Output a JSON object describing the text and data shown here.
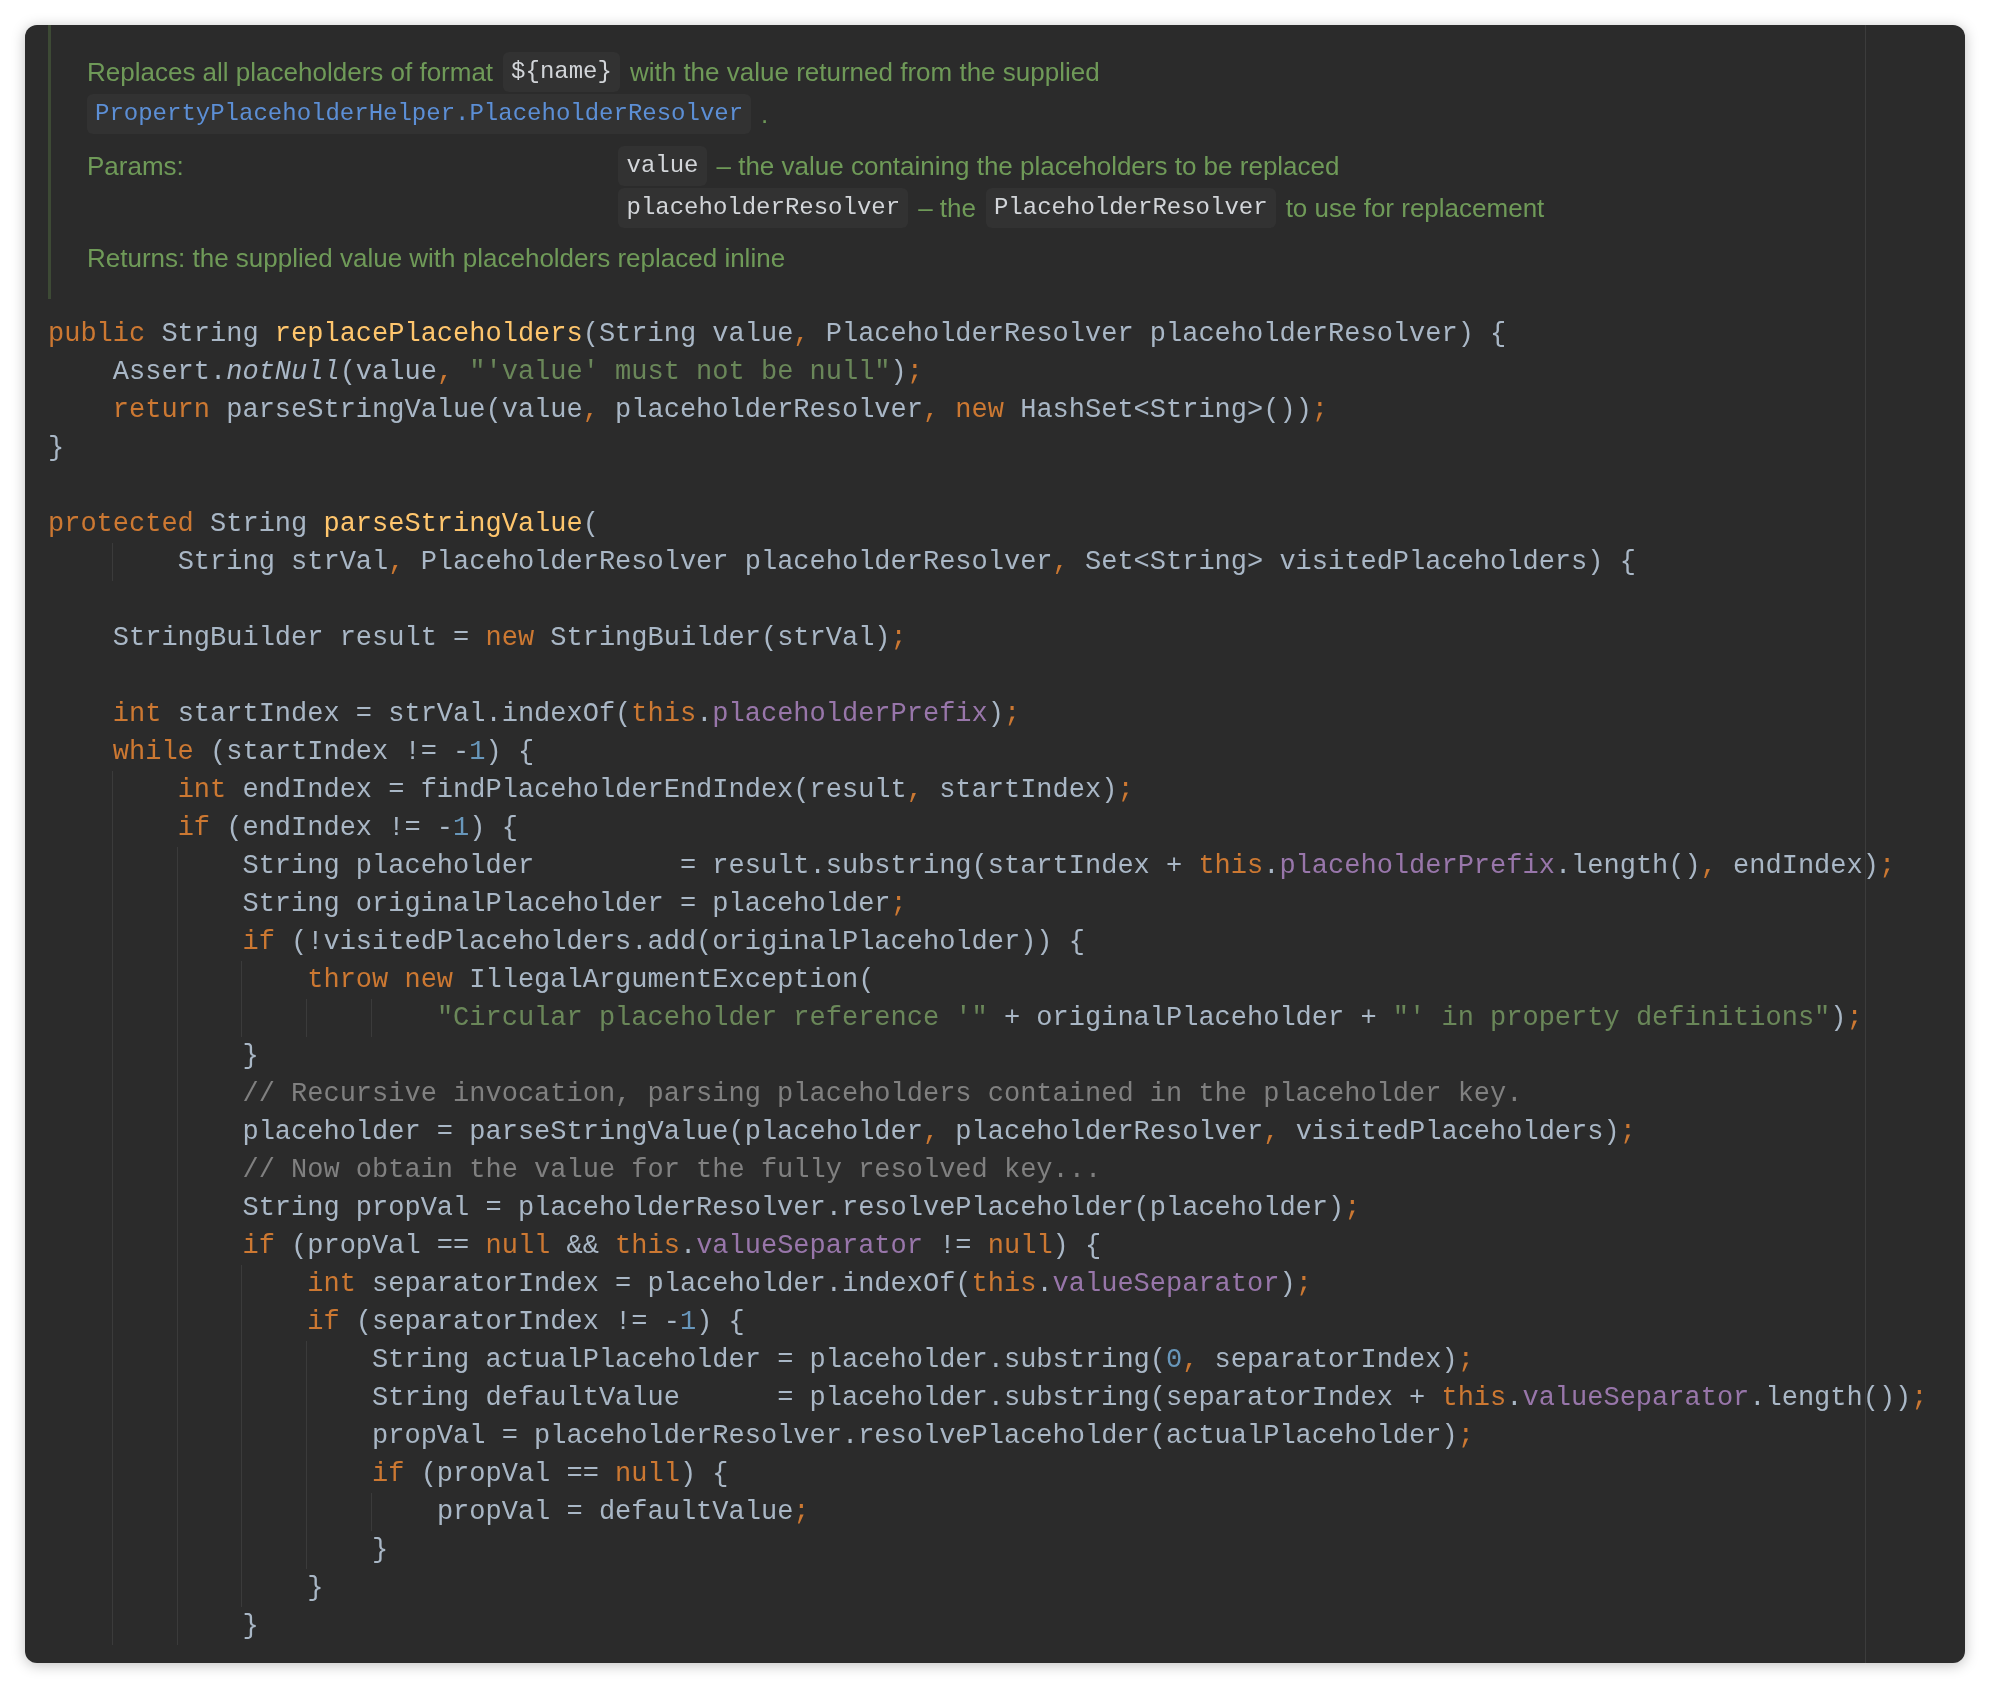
{
  "doc": {
    "summary": [
      [
        {
          "kind": "text",
          "text": "Replaces all placeholders of format"
        },
        {
          "kind": "code",
          "text": "${name}"
        },
        {
          "kind": "text",
          "text": "with the value returned from the supplied"
        }
      ],
      [
        {
          "kind": "link",
          "text": "PropertyPlaceholderHelper.PlaceholderResolver"
        },
        {
          "kind": "text",
          "text": "."
        }
      ]
    ],
    "params_label": "Params:",
    "params": [
      {
        "name": "value",
        "description": [
          {
            "kind": "text",
            "text": "– the value containing the placeholders to be replaced"
          }
        ]
      },
      {
        "name": "placeholderResolver",
        "description": [
          {
            "kind": "text",
            "text": "– the"
          },
          {
            "kind": "code",
            "text": "PlaceholderResolver"
          },
          {
            "kind": "text",
            "text": "to use for replacement"
          }
        ]
      }
    ],
    "returns": "Returns: the supplied value with placeholders replaced inline"
  },
  "code": [
    {
      "kind": "code",
      "tokens": [
        {
          "kind": "keyword",
          "text": "public "
        },
        {
          "kind": "plain",
          "text": "String "
        },
        {
          "kind": "method",
          "text": "replacePlaceholders"
        },
        {
          "kind": "plain",
          "text": "(String value"
        },
        {
          "kind": "keyword",
          "text": ", "
        },
        {
          "kind": "plain",
          "text": "PlaceholderResolver placeholderResolver) {"
        }
      ]
    },
    {
      "kind": "code",
      "tokens": [
        {
          "kind": "plain",
          "text": "    Assert."
        },
        {
          "kind": "italic",
          "text": "notNull"
        },
        {
          "kind": "plain",
          "text": "(value"
        },
        {
          "kind": "keyword",
          "text": ", "
        },
        {
          "kind": "string",
          "text": "\"'value' must not be null\""
        },
        {
          "kind": "plain",
          "text": ")"
        },
        {
          "kind": "keyword",
          "text": ";"
        }
      ]
    },
    {
      "kind": "code",
      "tokens": [
        {
          "kind": "keyword",
          "text": "    return "
        },
        {
          "kind": "plain",
          "text": "parseStringValue(value"
        },
        {
          "kind": "keyword",
          "text": ", "
        },
        {
          "kind": "plain",
          "text": "placeholderResolver"
        },
        {
          "kind": "keyword",
          "text": ", new "
        },
        {
          "kind": "plain",
          "text": "HashSet<String>())"
        },
        {
          "kind": "keyword",
          "text": ";"
        }
      ]
    },
    {
      "kind": "code",
      "tokens": [
        {
          "kind": "plain",
          "text": "}"
        }
      ]
    },
    {
      "kind": "blank"
    },
    {
      "kind": "code",
      "tokens": [
        {
          "kind": "keyword",
          "text": "protected "
        },
        {
          "kind": "plain",
          "text": "String "
        },
        {
          "kind": "method",
          "text": "parseStringValue"
        },
        {
          "kind": "plain",
          "text": "("
        }
      ]
    },
    {
      "kind": "code",
      "tokens": [
        {
          "kind": "plain",
          "text": "        String strVal"
        },
        {
          "kind": "keyword",
          "text": ", "
        },
        {
          "kind": "plain",
          "text": "PlaceholderResolver placeholderResolver"
        },
        {
          "kind": "keyword",
          "text": ", "
        },
        {
          "kind": "plain",
          "text": "Set<String> visitedPlaceholders) {"
        }
      ]
    },
    {
      "kind": "blank"
    },
    {
      "kind": "code",
      "tokens": [
        {
          "kind": "plain",
          "text": "    StringBuilder result = "
        },
        {
          "kind": "keyword",
          "text": "new "
        },
        {
          "kind": "plain",
          "text": "StringBuilder(strVal)"
        },
        {
          "kind": "keyword",
          "text": ";"
        }
      ]
    },
    {
      "kind": "blank"
    },
    {
      "kind": "code",
      "tokens": [
        {
          "kind": "keyword",
          "text": "    int "
        },
        {
          "kind": "plain",
          "text": "startIndex = strVal.indexOf("
        },
        {
          "kind": "keyword",
          "text": "this"
        },
        {
          "kind": "plain",
          "text": "."
        },
        {
          "kind": "field",
          "text": "placeholderPrefix"
        },
        {
          "kind": "plain",
          "text": ")"
        },
        {
          "kind": "keyword",
          "text": ";"
        }
      ]
    },
    {
      "kind": "code",
      "tokens": [
        {
          "kind": "keyword",
          "text": "    while "
        },
        {
          "kind": "plain",
          "text": "(startIndex != -"
        },
        {
          "kind": "number",
          "text": "1"
        },
        {
          "kind": "plain",
          "text": ") {"
        }
      ]
    },
    {
      "kind": "code",
      "tokens": [
        {
          "kind": "keyword",
          "text": "        int "
        },
        {
          "kind": "plain",
          "text": "endIndex = findPlaceholderEndIndex(result"
        },
        {
          "kind": "keyword",
          "text": ", "
        },
        {
          "kind": "plain",
          "text": "startIndex)"
        },
        {
          "kind": "keyword",
          "text": ";"
        }
      ]
    },
    {
      "kind": "code",
      "tokens": [
        {
          "kind": "keyword",
          "text": "        if "
        },
        {
          "kind": "plain",
          "text": "(endIndex != -"
        },
        {
          "kind": "number",
          "text": "1"
        },
        {
          "kind": "plain",
          "text": ") {"
        }
      ]
    },
    {
      "kind": "code",
      "tokens": [
        {
          "kind": "plain",
          "text": "            String placeholder         = result.substring(startIndex + "
        },
        {
          "kind": "keyword",
          "text": "this"
        },
        {
          "kind": "plain",
          "text": "."
        },
        {
          "kind": "field",
          "text": "placeholderPrefix"
        },
        {
          "kind": "plain",
          "text": ".length()"
        },
        {
          "kind": "keyword",
          "text": ", "
        },
        {
          "kind": "plain",
          "text": "endIndex)"
        },
        {
          "kind": "keyword",
          "text": ";"
        }
      ]
    },
    {
      "kind": "code",
      "tokens": [
        {
          "kind": "plain",
          "text": "            String originalPlaceholder = placeholder"
        },
        {
          "kind": "keyword",
          "text": ";"
        }
      ]
    },
    {
      "kind": "code",
      "tokens": [
        {
          "kind": "keyword",
          "text": "            if "
        },
        {
          "kind": "plain",
          "text": "(!visitedPlaceholders.add(originalPlaceholder)) {"
        }
      ]
    },
    {
      "kind": "code",
      "tokens": [
        {
          "kind": "keyword",
          "text": "                throw new "
        },
        {
          "kind": "plain",
          "text": "IllegalArgumentException("
        }
      ]
    },
    {
      "kind": "code",
      "tokens": [
        {
          "kind": "string",
          "text": "                        \"Circular placeholder reference '\""
        },
        {
          "kind": "plain",
          "text": " + originalPlaceholder + "
        },
        {
          "kind": "string",
          "text": "\"' in property definitions\""
        },
        {
          "kind": "plain",
          "text": ")"
        },
        {
          "kind": "keyword",
          "text": ";"
        }
      ]
    },
    {
      "kind": "code",
      "tokens": [
        {
          "kind": "plain",
          "text": "            }"
        }
      ]
    },
    {
      "kind": "code",
      "tokens": [
        {
          "kind": "comment",
          "text": "            // Recursive invocation, parsing placeholders contained in the placeholder key."
        }
      ]
    },
    {
      "kind": "code",
      "tokens": [
        {
          "kind": "plain",
          "text": "            placeholder = parseStringValue(placeholder"
        },
        {
          "kind": "keyword",
          "text": ", "
        },
        {
          "kind": "plain",
          "text": "placeholderResolver"
        },
        {
          "kind": "keyword",
          "text": ", "
        },
        {
          "kind": "plain",
          "text": "visitedPlaceholders)"
        },
        {
          "kind": "keyword",
          "text": ";"
        }
      ]
    },
    {
      "kind": "code",
      "tokens": [
        {
          "kind": "comment",
          "text": "            // Now obtain the value for the fully resolved key..."
        }
      ]
    },
    {
      "kind": "code",
      "tokens": [
        {
          "kind": "plain",
          "text": "            String propVal = placeholderResolver.resolvePlaceholder(placeholder)"
        },
        {
          "kind": "keyword",
          "text": ";"
        }
      ]
    },
    {
      "kind": "code",
      "tokens": [
        {
          "kind": "keyword",
          "text": "            if "
        },
        {
          "kind": "plain",
          "text": "(propVal == "
        },
        {
          "kind": "keyword",
          "text": "null "
        },
        {
          "kind": "plain",
          "text": "&& "
        },
        {
          "kind": "keyword",
          "text": "this"
        },
        {
          "kind": "plain",
          "text": "."
        },
        {
          "kind": "field",
          "text": "valueSeparator"
        },
        {
          "kind": "plain",
          "text": " != "
        },
        {
          "kind": "keyword",
          "text": "null"
        },
        {
          "kind": "plain",
          "text": ") {"
        }
      ]
    },
    {
      "kind": "code",
      "tokens": [
        {
          "kind": "keyword",
          "text": "                int "
        },
        {
          "kind": "plain",
          "text": "separatorIndex = placeholder.indexOf("
        },
        {
          "kind": "keyword",
          "text": "this"
        },
        {
          "kind": "plain",
          "text": "."
        },
        {
          "kind": "field",
          "text": "valueSeparator"
        },
        {
          "kind": "plain",
          "text": ")"
        },
        {
          "kind": "keyword",
          "text": ";"
        }
      ]
    },
    {
      "kind": "code",
      "tokens": [
        {
          "kind": "keyword",
          "text": "                if "
        },
        {
          "kind": "plain",
          "text": "(separatorIndex != -"
        },
        {
          "kind": "number",
          "text": "1"
        },
        {
          "kind": "plain",
          "text": ") {"
        }
      ]
    },
    {
      "kind": "code",
      "tokens": [
        {
          "kind": "plain",
          "text": "                    String actualPlaceholder = placeholder.substring("
        },
        {
          "kind": "number",
          "text": "0"
        },
        {
          "kind": "keyword",
          "text": ", "
        },
        {
          "kind": "plain",
          "text": "separatorIndex)"
        },
        {
          "kind": "keyword",
          "text": ";"
        }
      ]
    },
    {
      "kind": "code",
      "tokens": [
        {
          "kind": "plain",
          "text": "                    String defaultValue      = placeholder.substring(separatorIndex + "
        },
        {
          "kind": "keyword",
          "text": "this"
        },
        {
          "kind": "plain",
          "text": "."
        },
        {
          "kind": "field",
          "text": "valueSeparator"
        },
        {
          "kind": "plain",
          "text": ".length())"
        },
        {
          "kind": "keyword",
          "text": ";"
        }
      ]
    },
    {
      "kind": "code",
      "tokens": [
        {
          "kind": "plain",
          "text": "                    propVal = placeholderResolver.resolvePlaceholder(actualPlaceholder)"
        },
        {
          "kind": "keyword",
          "text": ";"
        }
      ]
    },
    {
      "kind": "code",
      "tokens": [
        {
          "kind": "keyword",
          "text": "                    if "
        },
        {
          "kind": "plain",
          "text": "(propVal == "
        },
        {
          "kind": "keyword",
          "text": "null"
        },
        {
          "kind": "plain",
          "text": ") {"
        }
      ]
    },
    {
      "kind": "code",
      "tokens": [
        {
          "kind": "plain",
          "text": "                        propVal = defaultValue"
        },
        {
          "kind": "keyword",
          "text": ";"
        }
      ]
    },
    {
      "kind": "code",
      "tokens": [
        {
          "kind": "plain",
          "text": "                    }"
        }
      ]
    },
    {
      "kind": "code",
      "tokens": [
        {
          "kind": "plain",
          "text": "                }"
        }
      ]
    },
    {
      "kind": "code",
      "tokens": [
        {
          "kind": "plain",
          "text": "            }"
        }
      ]
    }
  ]
}
